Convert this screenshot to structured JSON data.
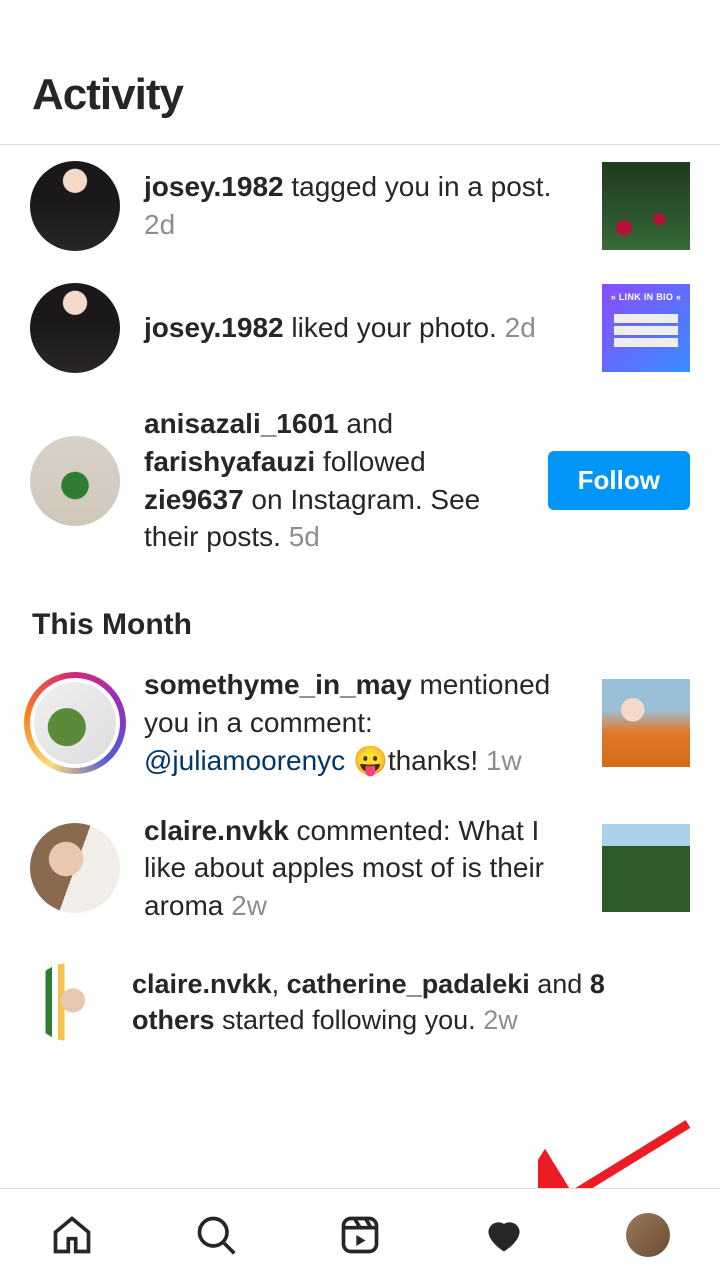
{
  "header": {
    "title": "Activity"
  },
  "sections": {
    "recent": [
      {
        "avatar_class": "av-josey",
        "username": "josey.1982",
        "action": " tagged you in a post. ",
        "time": "2d",
        "thumb": "th-plant"
      },
      {
        "avatar_class": "av-josey",
        "username": "josey.1982",
        "action": " liked your photo. ",
        "time": "2d",
        "thumb": "th-linkbio"
      },
      {
        "avatar_class": "av-machine",
        "user1": "anisazali_1601",
        "join": " and ",
        "user2": "farishyafauzi",
        "mid": " followed ",
        "user3": "zie9637",
        "tail": " on Instagram. See their posts. ",
        "time": "5d",
        "follow_label": "Follow"
      }
    ],
    "this_month_title": "This Month",
    "this_month": [
      {
        "has_story": true,
        "avatar_class": "av-thyme",
        "username": "somethyme_in_may",
        "action": " mentioned you in a comment: ",
        "mention": "@juliamoorenyc",
        "emoji": "😛",
        "tail": "thanks! ",
        "time": "1w",
        "thumb": "th-carrots"
      },
      {
        "avatar_class": "av-claire",
        "username": "claire.nvkk",
        "action": " commented: What I like about apples most of is their aroma ",
        "time": "2w",
        "thumb": "th-bush"
      },
      {
        "small": true,
        "avatar_class": "av-claire2",
        "user1": "claire.nvkk",
        "sep": ", ",
        "user2": "catherine_padaleki",
        "join": " and ",
        "user3": "8 others",
        "tail": " started following you. ",
        "time": "2w"
      }
    ]
  },
  "nav": {
    "home": "home",
    "search": "search",
    "reels": "reels",
    "activity": "activity",
    "profile": "profile"
  }
}
